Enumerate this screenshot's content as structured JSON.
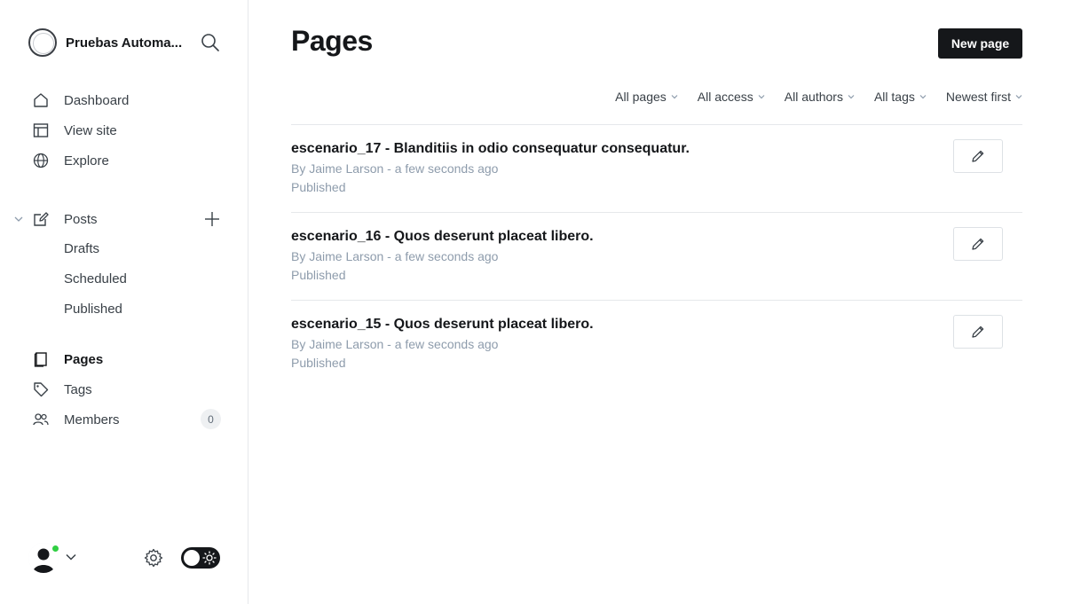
{
  "sidebar": {
    "site_name": "Pruebas Automa...",
    "nav": {
      "dashboard": "Dashboard",
      "view_site": "View site",
      "explore": "Explore",
      "posts": "Posts",
      "drafts": "Drafts",
      "scheduled": "Scheduled",
      "published": "Published",
      "pages": "Pages",
      "tags": "Tags",
      "members": "Members",
      "members_count": "0"
    }
  },
  "header": {
    "title": "Pages",
    "new_button": "New page"
  },
  "filters": [
    "All pages",
    "All access",
    "All authors",
    "All tags",
    "Newest first"
  ],
  "pages": [
    {
      "title": "escenario_17 - Blanditiis in odio consequatur consequatur.",
      "meta": "By Jaime Larson - a few seconds ago",
      "status": "Published"
    },
    {
      "title": "escenario_16 - Quos deserunt placeat libero.",
      "meta": "By Jaime Larson - a few seconds ago",
      "status": "Published"
    },
    {
      "title": "escenario_15 - Quos deserunt placeat libero.",
      "meta": "By Jaime Larson - a few seconds ago",
      "status": "Published"
    }
  ],
  "colors": {
    "accent": "#15171a",
    "online": "#30cf43",
    "muted": "#8e9cac"
  }
}
